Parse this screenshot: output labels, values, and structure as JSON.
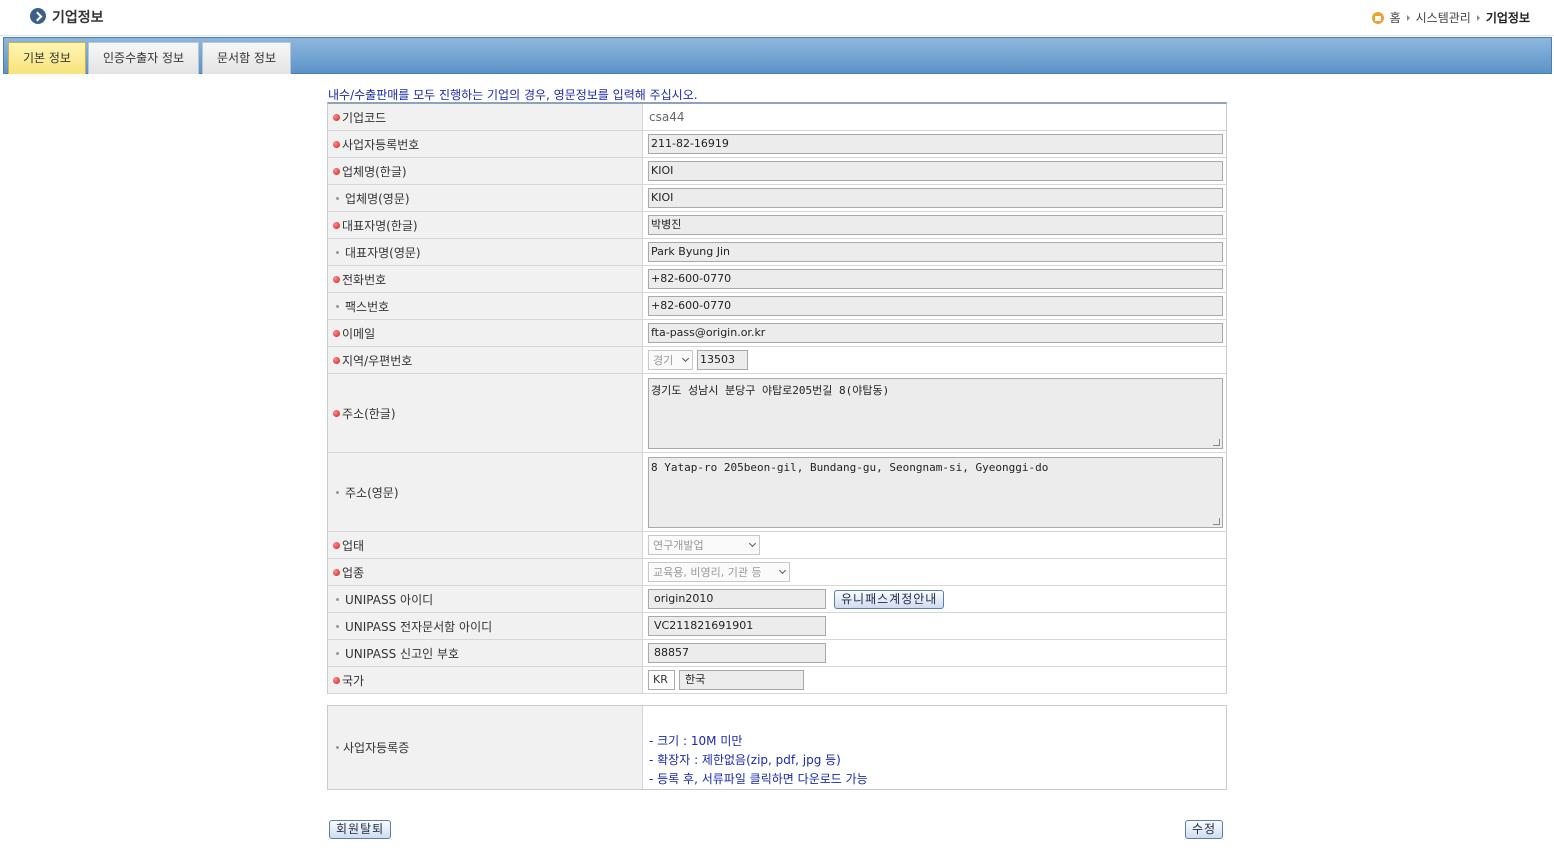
{
  "header": {
    "title": "기업정보",
    "breadcrumb": [
      "홈",
      "시스템관리",
      "기업정보"
    ]
  },
  "tabs": [
    {
      "label": "기본 정보",
      "active": true
    },
    {
      "label": "인증수출자 정보",
      "active": false
    },
    {
      "label": "문서함 정보",
      "active": false
    }
  ],
  "notice": "내수/수출판매를 모두 진행하는 기업의 경우, 영문정보를 입력해 주십시오.",
  "form": {
    "company_code": {
      "label": "기업코드",
      "value": "csa44"
    },
    "biz_reg_no": {
      "label": "사업자등록번호",
      "value": "211-82-16919"
    },
    "name_kr": {
      "label": "업체명(한글)",
      "value": "KIOI"
    },
    "name_en": {
      "label": "업체명(영문)",
      "value": "KIOI"
    },
    "ceo_kr": {
      "label": "대표자명(한글)",
      "value": "박병진"
    },
    "ceo_en": {
      "label": "대표자명(영문)",
      "value": "Park Byung Jin"
    },
    "phone": {
      "label": "전화번호",
      "value": "+82-600-0770"
    },
    "fax": {
      "label": "팩스번호",
      "value": "+82-600-0770"
    },
    "email": {
      "label": "이메일",
      "value": "fta-pass@origin.or.kr"
    },
    "region": {
      "label": "지역/우편번호",
      "region_value": "경기",
      "zip": "13503"
    },
    "addr_kr": {
      "label": "주소(한글)",
      "value": "경기도 성남시 분당구 야탑로205번길 8(야탑동)"
    },
    "addr_en": {
      "label": "주소(영문)",
      "value": "8 Yatap-ro 205beon-gil, Bundang-gu, Seongnam-si, Gyeonggi-do"
    },
    "biz_type": {
      "label": "업태",
      "value": "연구개발업"
    },
    "biz_item": {
      "label": "업종",
      "value": "교육용, 비영리, 기관 등"
    },
    "unipass_id": {
      "label": "UNIPASS 아이디",
      "value": "origin2010",
      "guide_button": "유니패스계정안내"
    },
    "unipass_box_id": {
      "label": "UNIPASS 전자문서함 아이디",
      "value": "VC211821691901"
    },
    "unipass_code": {
      "label": "UNIPASS 신고인 부호",
      "value": "88857"
    },
    "country": {
      "label": "국가",
      "code": "KR",
      "name": "한국"
    }
  },
  "attachment": {
    "label": "사업자등록증",
    "info": [
      "- 크기 : 10M 미만",
      "- 확장자 : 제한없음(zip, pdf, jpg 등)",
      "- 등록 후, 서류파일 클릭하면 다운로드 가능"
    ]
  },
  "buttons": {
    "withdraw": "회원탈퇴",
    "edit": "수정"
  }
}
